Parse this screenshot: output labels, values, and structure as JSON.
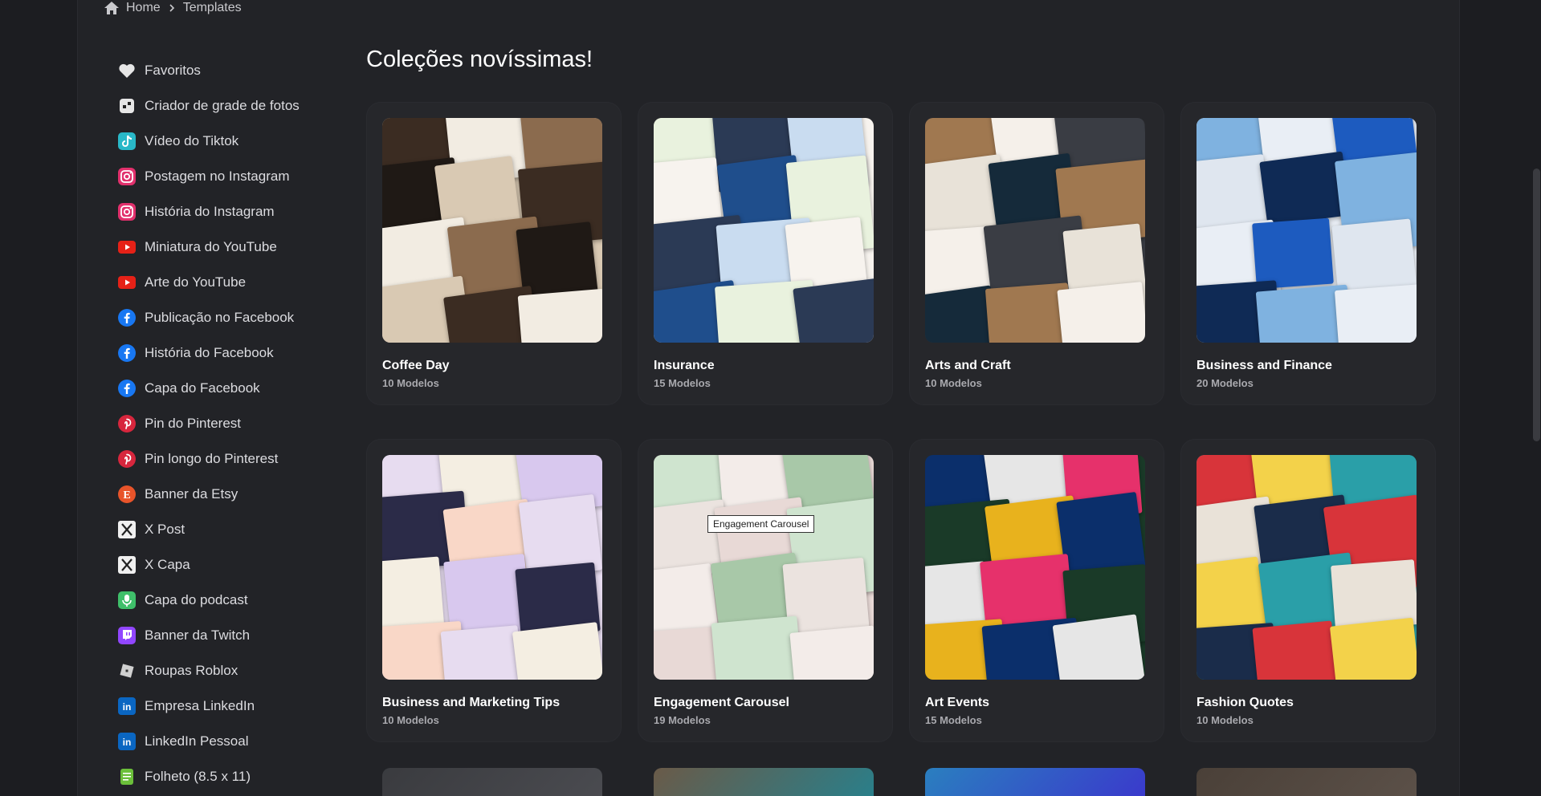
{
  "breadcrumb": {
    "home": "Home",
    "current": "Templates"
  },
  "main": {
    "title": "Coleções novíssimas!"
  },
  "sidebar": {
    "items": [
      {
        "label": "Favoritos",
        "icon": "heart-icon",
        "color": "#e6e6e6"
      },
      {
        "label": "Criador de grade de fotos",
        "icon": "photo-grid-icon",
        "color": "#e6e6e6"
      },
      {
        "label": "Vídeo do Tiktok",
        "icon": "tiktok-icon",
        "color": "#29b8c8"
      },
      {
        "label": "Postagem no Instagram",
        "icon": "instagram-icon",
        "color": "#e1306c"
      },
      {
        "label": "História do Instagram",
        "icon": "instagram-icon",
        "color": "#e1306c"
      },
      {
        "label": "Miniatura do YouTube",
        "icon": "youtube-icon",
        "color": "#e62117"
      },
      {
        "label": "Arte do YouTube",
        "icon": "youtube-icon",
        "color": "#e62117"
      },
      {
        "label": "Publicação no Facebook",
        "icon": "facebook-icon",
        "color": "#1877f2"
      },
      {
        "label": "História do Facebook",
        "icon": "facebook-icon",
        "color": "#1877f2"
      },
      {
        "label": "Capa do Facebook",
        "icon": "facebook-icon",
        "color": "#1877f2"
      },
      {
        "label": "Pin do Pinterest",
        "icon": "pinterest-icon",
        "color": "#d7263d"
      },
      {
        "label": "Pin longo do Pinterest",
        "icon": "pinterest-icon",
        "color": "#d7263d"
      },
      {
        "label": "Banner da Etsy",
        "icon": "etsy-icon",
        "color": "#e8542a"
      },
      {
        "label": "X Post",
        "icon": "x-icon",
        "color": "#f0f0f0"
      },
      {
        "label": "X Capa",
        "icon": "x-icon",
        "color": "#f0f0f0"
      },
      {
        "label": "Capa do podcast",
        "icon": "microphone-icon",
        "color": "#3fbf6a"
      },
      {
        "label": "Banner da Twitch",
        "icon": "twitch-icon",
        "color": "#9146ff"
      },
      {
        "label": "Roupas Roblox",
        "icon": "roblox-icon",
        "color": "#d0d0d0"
      },
      {
        "label": "Empresa LinkedIn",
        "icon": "linkedin-icon",
        "color": "#0a66c2"
      },
      {
        "label": "LinkedIn Pessoal",
        "icon": "linkedin-icon",
        "color": "#0a66c2"
      },
      {
        "label": "Folheto (8.5 x 11)",
        "icon": "flyer-icon",
        "color": "#6bbf3a"
      }
    ]
  },
  "collections": [
    {
      "title": "Coffee Day",
      "count": "10 Modelos",
      "palette": [
        "#d9c9b3",
        "#3b2c22",
        "#f2ece2",
        "#8b6b4e",
        "#1f1915"
      ]
    },
    {
      "title": "Insurance",
      "count": "15 Modelos",
      "palette": [
        "#f7f3ee",
        "#1f4e8c",
        "#e9f2de",
        "#2b3a55",
        "#c9dcf0"
      ]
    },
    {
      "title": "Arts and Craft",
      "count": "10 Modelos",
      "palette": [
        "#3a3d44",
        "#e8e2d8",
        "#152a3a",
        "#a07850",
        "#f5f0ea"
      ]
    },
    {
      "title": "Business and Finance",
      "count": "20 Modelos",
      "palette": [
        "#e9eef5",
        "#1d5bbf",
        "#dfe6ef",
        "#0f2a55",
        "#7fb2e0"
      ]
    },
    {
      "title": "Business and Marketing Tips",
      "count": "10 Modelos",
      "palette": [
        "#e7dcf0",
        "#f4eee2",
        "#d8c8ee",
        "#2b2b48",
        "#f9d7c7"
      ]
    },
    {
      "title": "Engagement Carousel",
      "count": "19 Modelos",
      "palette": [
        "#e8d9d6",
        "#cfe4cf",
        "#f3ece9",
        "#a8c8a8",
        "#ebe3df"
      ]
    },
    {
      "title": "Art Events",
      "count": "15 Modelos",
      "palette": [
        "#1a3a28",
        "#e8b21d",
        "#0b2f6b",
        "#e6e6e6",
        "#e6316b"
      ]
    },
    {
      "title": "Fashion Quotes",
      "count": "10 Modelos",
      "palette": [
        "#2a9fa8",
        "#e9e2d8",
        "#1a2c4a",
        "#d8343a",
        "#f3d24a"
      ]
    }
  ],
  "peek_row": [
    {
      "palette": [
        "#3a3b3f",
        "#4a4b50"
      ]
    },
    {
      "palette": [
        "#6a5a48",
        "#2a7f8a"
      ]
    },
    {
      "palette": [
        "#2a7fbf",
        "#3a3acc"
      ]
    },
    {
      "palette": [
        "#4a4038",
        "#5b5048"
      ]
    }
  ],
  "tooltip": {
    "text": "Engagement Carousel"
  }
}
